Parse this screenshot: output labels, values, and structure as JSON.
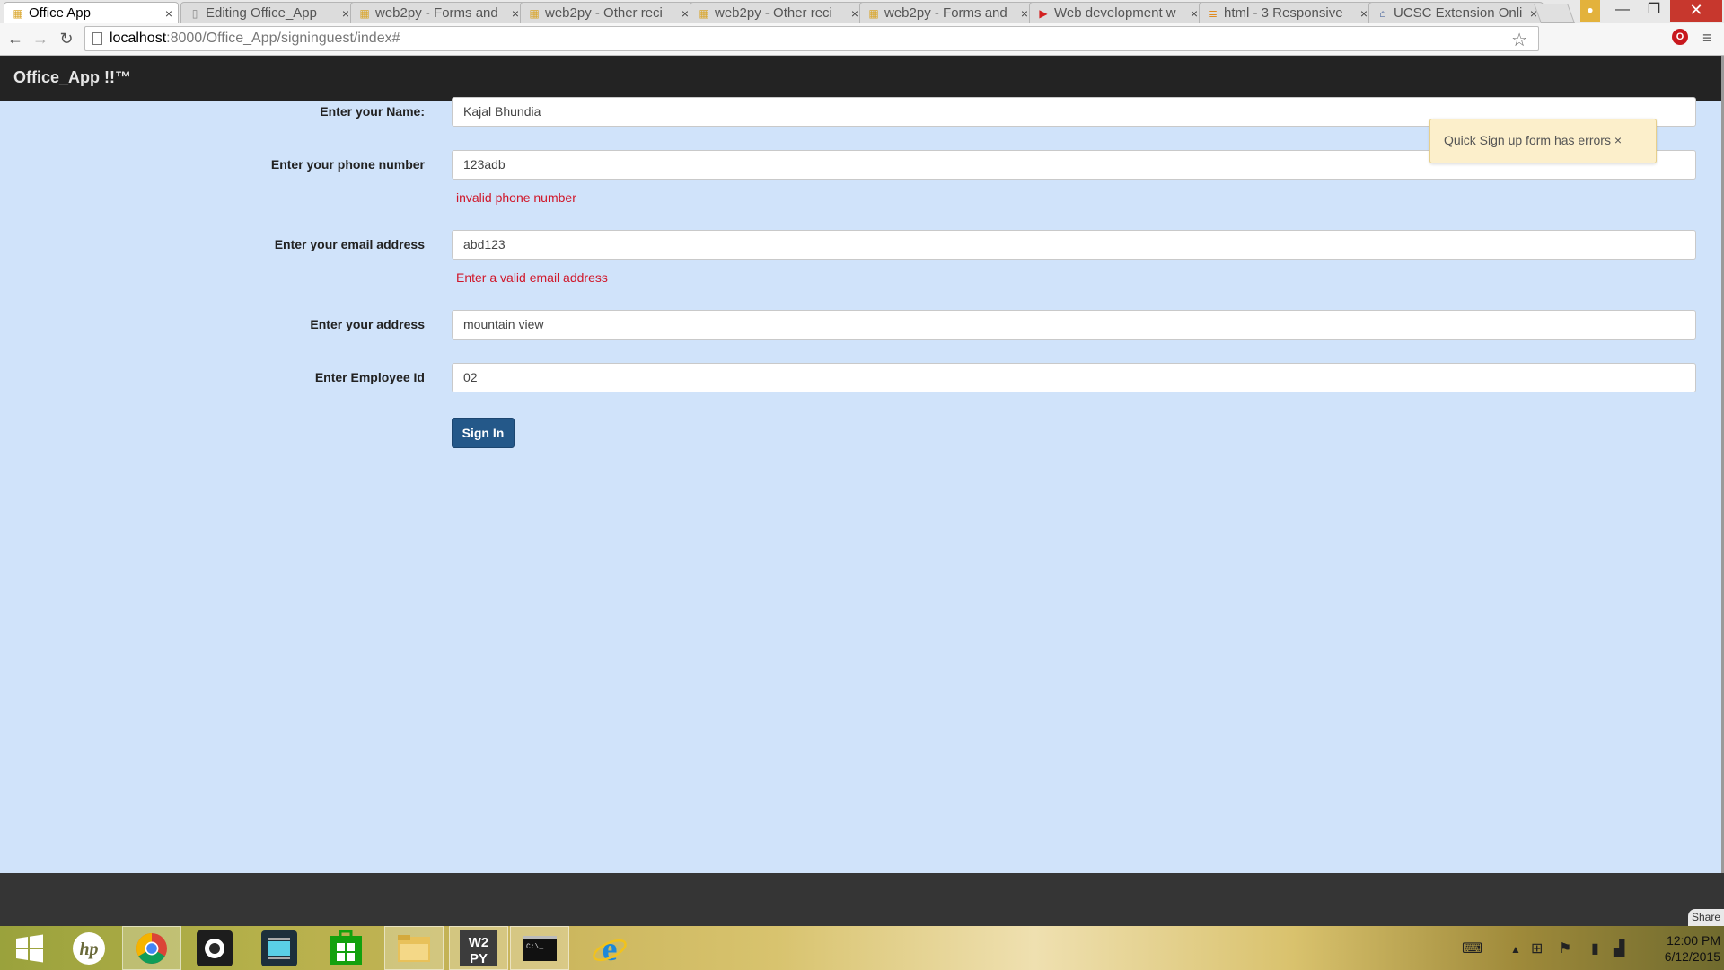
{
  "browser": {
    "tabs": [
      {
        "title": "Office App",
        "active": true
      },
      {
        "title": "Editing Office_App",
        "active": false
      },
      {
        "title": "web2py - Forms and",
        "active": false
      },
      {
        "title": "web2py - Other reci",
        "active": false
      },
      {
        "title": "web2py - Other reci",
        "active": false
      },
      {
        "title": "web2py - Forms and",
        "active": false
      },
      {
        "title": "Web development w",
        "active": false
      },
      {
        "title": "html - 3 Responsive",
        "active": false
      },
      {
        "title": "UCSC Extension Onli",
        "active": false
      }
    ],
    "url_host": "localhost",
    "url_rest": ":8000/Office_App/signinguest/index#"
  },
  "app": {
    "brand": "Office_App !!™",
    "flash": "Quick Sign up form has errors ×",
    "fields": [
      {
        "label": "Enter your Name:",
        "value": "Kajal Bhundia",
        "error": ""
      },
      {
        "label": "Enter your phone number",
        "value": "123adb",
        "error": "invalid phone number"
      },
      {
        "label": "Enter your email address",
        "value": "abd123",
        "error": "Enter a valid email address"
      },
      {
        "label": "Enter your address",
        "value": "mountain view",
        "error": ""
      },
      {
        "label": "Enter Employee Id",
        "value": "02",
        "error": ""
      }
    ],
    "submit_label": "Sign In",
    "share_label": "Share"
  },
  "taskbar": {
    "time": "12:00 PM",
    "date": "6/12/2015"
  }
}
